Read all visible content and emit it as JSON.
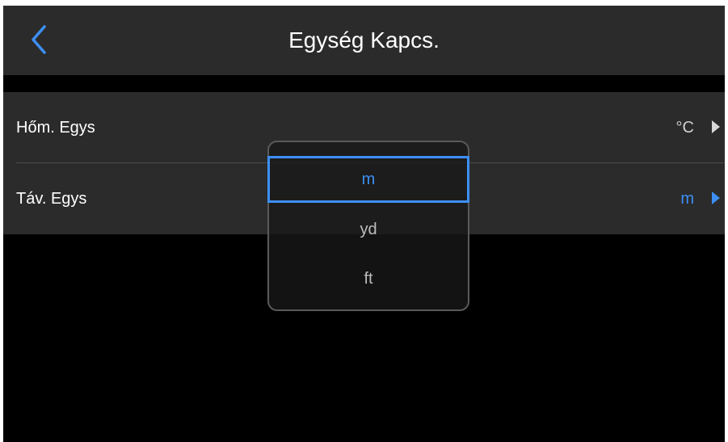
{
  "header": {
    "title": "Egység Kapcs.",
    "back_icon": "chevron-left-icon",
    "accent_color": "#3d8ff5"
  },
  "settings": [
    {
      "label": "Hőm. Egys",
      "value": "°C"
    },
    {
      "label": "Táv. Egys",
      "value": "m"
    }
  ],
  "picker": {
    "options": [
      "m",
      "yd",
      "ft"
    ],
    "selected": "m"
  }
}
